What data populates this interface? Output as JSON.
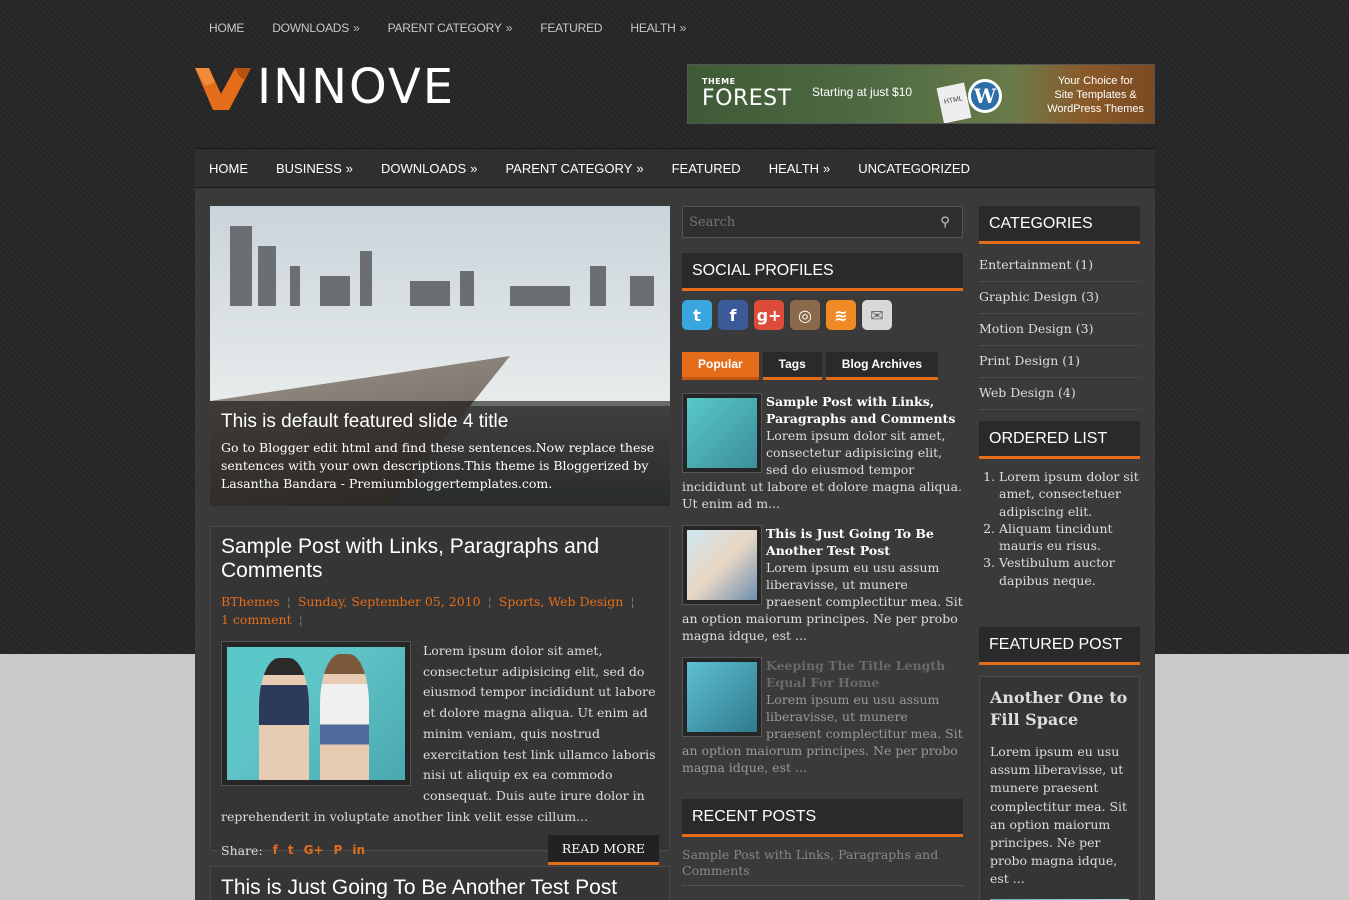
{
  "top_nav": [
    {
      "label": "HOME",
      "has_sub": false
    },
    {
      "label": "DOWNLOADS",
      "has_sub": true
    },
    {
      "label": "PARENT CATEGORY",
      "has_sub": true
    },
    {
      "label": "FEATURED",
      "has_sub": false
    },
    {
      "label": "HEALTH",
      "has_sub": true
    }
  ],
  "logo": {
    "text": "INNOVE"
  },
  "banner": {
    "brand_small": "THEME",
    "brand": "FOREST",
    "offer": "Starting at just $10",
    "tagline_1": "Your Choice for",
    "tagline_2": "Site Templates &",
    "tagline_3": "WordPress Themes",
    "doc_label": "HTML"
  },
  "main_nav": [
    {
      "label": "HOME",
      "has_sub": false
    },
    {
      "label": "BUSINESS",
      "has_sub": true
    },
    {
      "label": "DOWNLOADS",
      "has_sub": true
    },
    {
      "label": "PARENT CATEGORY",
      "has_sub": true
    },
    {
      "label": "FEATURED",
      "has_sub": false
    },
    {
      "label": "HEALTH",
      "has_sub": true
    },
    {
      "label": "UNCATEGORIZED",
      "has_sub": false
    }
  ],
  "slider": {
    "title": "This is default featured slide 4 title",
    "text": "Go to Blogger edit html and find these sentences.Now replace these sentences with your own descriptions.This theme is Bloggerized by Lasantha Bandara - Premiumbloggertemplates.com."
  },
  "post1": {
    "title": "Sample Post with Links, Paragraphs and Comments",
    "author": "BThemes",
    "date": "Sunday, September 05, 2010",
    "labels": [
      "Sports",
      "Web Design"
    ],
    "comments": "1 comment",
    "excerpt": "Lorem ipsum dolor sit amet, consectetur adipisicing elit, sed do eiusmod tempor incididunt ut labore et dolore magna aliqua. Ut enim ad minim veniam, quis nostrud exercitation test link ullamco laboris nisi ut aliquip ex ea commodo consequat. Duis aute irure dolor in reprehenderit in voluptate another link velit esse cillum...",
    "share_label": "Share:",
    "read_more": "READ MORE"
  },
  "post2": {
    "title": "This is Just Going To Be Another Test Post"
  },
  "search": {
    "placeholder": "Search"
  },
  "widgets": {
    "social_title": "SOCIAL PROFILES",
    "recent_title": "RECENT POSTS",
    "categories_title": "CATEGORIES",
    "ordered_title": "ORDERED LIST",
    "featured_title": "FEATURED POST"
  },
  "social_icons": [
    {
      "name": "twitter",
      "glyph": "t",
      "color": "#3aa6e0"
    },
    {
      "name": "facebook",
      "glyph": "f",
      "color": "#3b5a9a"
    },
    {
      "name": "google-plus",
      "glyph": "g+",
      "color": "#dd4b39"
    },
    {
      "name": "instagram",
      "glyph": "◎",
      "color": "#8a6a4a"
    },
    {
      "name": "rss",
      "glyph": "≋",
      "color": "#f08a24"
    },
    {
      "name": "email",
      "glyph": "✉",
      "color": "#d8d8d8"
    }
  ],
  "tabs": [
    {
      "label": "Popular",
      "active": true
    },
    {
      "label": "Tags",
      "active": false
    },
    {
      "label": "Blog Archives",
      "active": false
    }
  ],
  "popular": [
    {
      "title": "Sample Post with Links, Paragraphs and Comments",
      "excerpt": "Lorem ipsum dolor sit amet, consectetur adipisicing elit, sed do eiusmod tempor incididunt ut labore et dolore magna aliqua. Ut enim ad m..."
    },
    {
      "title": "This is Just Going To Be Another Test Post",
      "excerpt": "Lorem ipsum eu usu assum liberavisse, ut munere praesent complectitur mea. Sit an option maiorum principes. Ne per probo magna idque, est ..."
    },
    {
      "title": "Keeping The Title Length Equal For Home",
      "excerpt": "Lorem ipsum eu usu assum liberavisse, ut munere praesent complectitur mea. Sit an option maiorum principes. Ne per probo magna idque, est ..."
    }
  ],
  "recent_posts": [
    "Sample Post with Links, Paragraphs and Comments"
  ],
  "categories": [
    "Entertainment (1)",
    "Graphic Design (3)",
    "Motion Design (3)",
    "Print Design (1)",
    "Web Design (4)"
  ],
  "ordered_list": [
    "Lorem ipsum dolor sit amet, consectetuer adipiscing elit.",
    "Aliquam tincidunt mauris eu risus.",
    "Vestibulum auctor dapibus neque."
  ],
  "featured_post": {
    "title": "Another One to Fill Space",
    "excerpt": "Lorem ipsum eu usu assum liberavisse, ut munere praesent complectitur mea. Sit an option maiorum principes. Ne per probo magna idque, est ..."
  },
  "colors": {
    "accent": "#e56d1a",
    "dark_bg": "#262626"
  }
}
